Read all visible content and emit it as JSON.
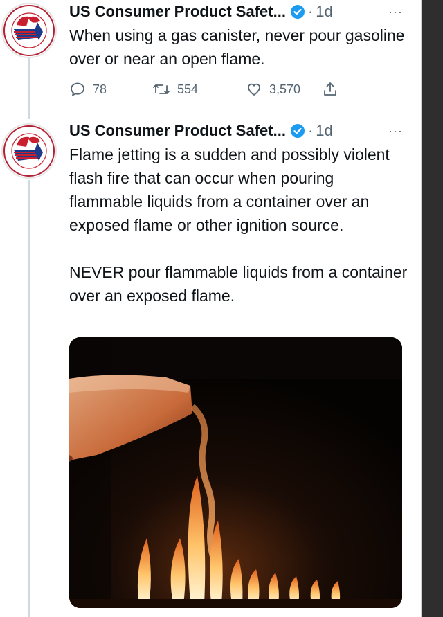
{
  "colors": {
    "verified": "#1d9bf0",
    "muted": "#536471",
    "text": "#0f1419",
    "thread_line": "#cfd9de",
    "logo_red": "#c8202f",
    "logo_blue": "#1e3a8a"
  },
  "icons": [
    "reply-icon",
    "retweet-icon",
    "like-icon",
    "share-icon",
    "verified-badge-icon",
    "more-icon"
  ],
  "tweets": [
    {
      "author": "US Consumer Product Safet...",
      "separator": "·",
      "time": "1d",
      "more": "···",
      "avatar_ring_top": "PRODUCT SAFETY",
      "avatar_ring_bottom": "UNITED STATES",
      "text": "When using a gas canister, never pour gasoline over or near an open flame.",
      "stats": {
        "replies": "78",
        "retweets": "554",
        "likes": "3,570"
      }
    },
    {
      "author": "US Consumer Product Safet...",
      "separator": "·",
      "time": "1d",
      "more": "···",
      "avatar_ring_top": "PRODUCT SAFETY",
      "avatar_ring_bottom": "UNITED STATES",
      "text_paragraph_1": "Flame jetting is a sudden and possibly violent flash fire that can occur when pouring flammable liquids from a container over an exposed flame or other ignition source.",
      "text_paragraph_2": "NEVER pour flammable liquids from a container over an exposed flame.",
      "media": {
        "kind": "video",
        "subject": "liquid poured from canister over flames"
      }
    }
  ]
}
